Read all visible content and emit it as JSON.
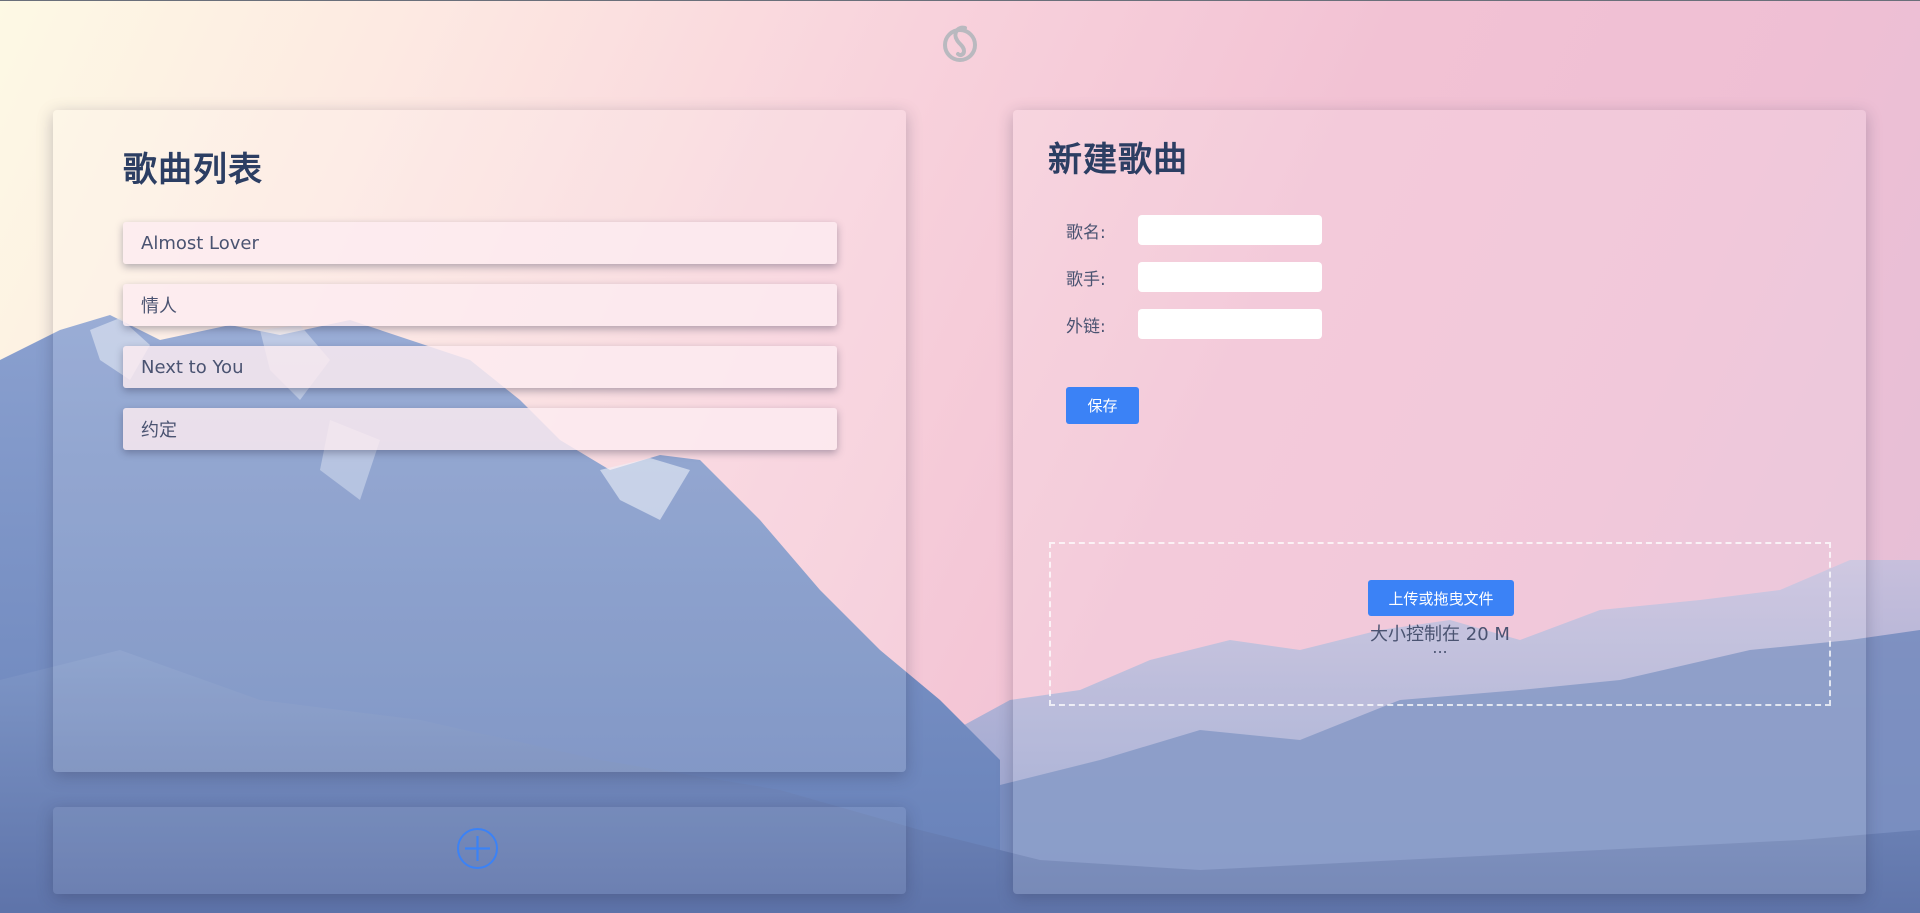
{
  "logo": {
    "icon": "netease-music-logo-icon"
  },
  "song_list": {
    "title": "歌曲列表",
    "songs": [
      {
        "name": "Almost Lover"
      },
      {
        "name": "情人"
      },
      {
        "name": "Next to You"
      },
      {
        "name": "约定"
      }
    ]
  },
  "footer": {
    "add_icon": "add-circle-icon",
    "accent": "#3b82f6"
  },
  "new_song": {
    "title": "新建歌曲",
    "fields": {
      "name_label": "歌名:",
      "name_value": "",
      "singer_label": "歌手:",
      "singer_value": "",
      "link_label": "外链:",
      "link_value": ""
    },
    "save_label": "保存",
    "upload": {
      "button_label": "上传或拖曳文件",
      "hint": "大小控制在 20 M",
      "status": "..."
    }
  },
  "colors": {
    "accent": "#3b82f6",
    "heading": "#2c3e63",
    "text": "#4a5371"
  }
}
